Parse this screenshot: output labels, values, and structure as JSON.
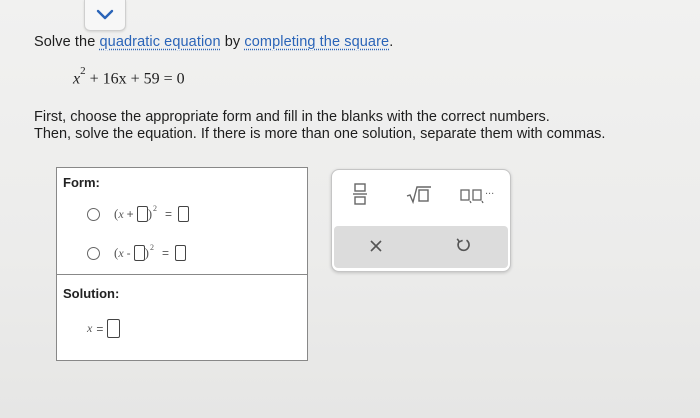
{
  "prompt": {
    "before": "Solve the ",
    "link1": "quadratic equation",
    "middle": " by ",
    "link2": "completing the square",
    "after": "."
  },
  "equation": {
    "var": "x",
    "exponent": "2",
    "rest": " + 16x + 59 = 0"
  },
  "instructions": {
    "line1": "First, choose the appropriate form and fill in the blanks with the correct numbers.",
    "line2": "Then, solve the equation. If there is more than one solution, separate them with commas."
  },
  "form": {
    "label": "Form:",
    "options": [
      {
        "var": "x",
        "sign": "+",
        "exp": "2"
      },
      {
        "var": "x",
        "sign": "-",
        "exp": "2"
      }
    ]
  },
  "solution": {
    "label": "Solution:",
    "var": "x",
    "eq": "="
  },
  "colors": {
    "link": "#2a64b8",
    "toolbar_bg": "#dcdcdc",
    "accent": "#2a64b8"
  },
  "toolbox": {
    "icons": [
      "fraction-icon",
      "sqrt-icon",
      "list-icon",
      "clear-icon",
      "undo-icon"
    ],
    "list_ellipsis": "..."
  }
}
